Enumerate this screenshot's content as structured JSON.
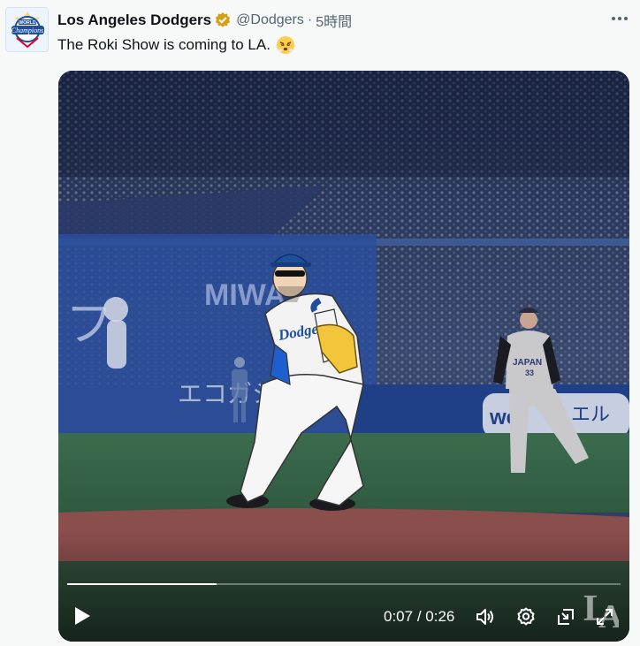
{
  "tweet": {
    "author_name": "Los Angeles Dodgers",
    "handle": "@Dodgers",
    "separator": "·",
    "timestamp": "5時間",
    "text": "The Roki Show is coming to LA.",
    "avatar_text": [
      "WORLD",
      "Champions"
    ]
  },
  "video": {
    "current_time": "0:07",
    "duration": "0:26",
    "time_separator": " / ",
    "progress": 0.27,
    "jersey_text": "Dodgers",
    "opponent_jersey_text": "JAPAN",
    "opponent_number": "33",
    "wall_text": "エコガシ",
    "sign_text": "MIWA",
    "ad_text": "we",
    "ad_text_right": "エル"
  },
  "colors": {
    "verified_badge": "#d4a018",
    "progress_fill": "#ffffff",
    "dodgers_blue": "#1e4f9c"
  }
}
